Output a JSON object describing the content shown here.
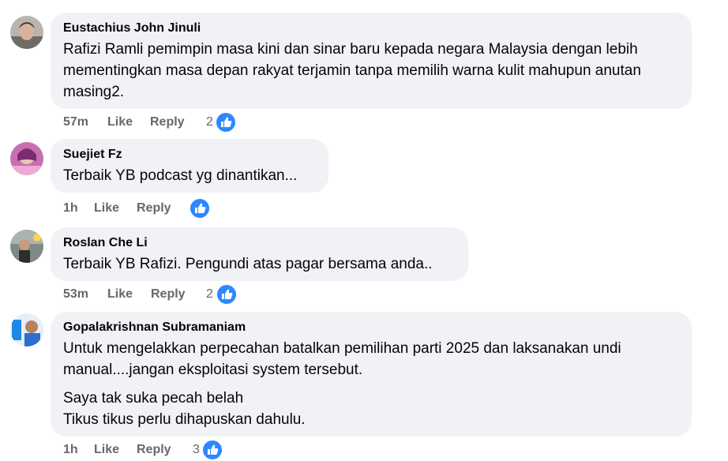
{
  "colors": {
    "bubble_bg": "#f0f2f5",
    "meta_text": "#65676b",
    "like_blue": "#2d88ff"
  },
  "comments": [
    {
      "author": "Eustachius John Jinuli",
      "paragraphs": [
        "Rafizi Ramli pemimpin masa kini dan sinar baru kepada negara Malaysia dengan lebih mementingkan masa depan rakyat terjamin tanpa memilih warna kulit mahupun anutan masing2."
      ],
      "time": "57m",
      "like_label": "Like",
      "reply_label": "Reply",
      "reaction_count": "2",
      "reaction_icon": "thumbs-up-icon"
    },
    {
      "author": "Suejiet Fz",
      "paragraphs": [
        "Terbaik YB podcast yg dinantikan..."
      ],
      "time": "1h",
      "like_label": "Like",
      "reply_label": "Reply",
      "reaction_count": "",
      "reaction_icon": "thumbs-up-icon"
    },
    {
      "author": "Roslan Che Li",
      "paragraphs": [
        "Terbaik YB Rafizi. Pengundi atas pagar bersama anda.."
      ],
      "time": "53m",
      "like_label": "Like",
      "reply_label": "Reply",
      "reaction_count": "2",
      "reaction_icon": "thumbs-up-icon"
    },
    {
      "author": "Gopalakrishnan Subramaniam",
      "paragraphs": [
        "Untuk mengelakkan perpecahan batalkan pemilihan parti 2025 dan laksanakan undi manual....jangan eksploitasi system tersebut.",
        "Saya tak suka pecah belah\nTikus tikus perlu dihapuskan dahulu."
      ],
      "time": "1h",
      "like_label": "Like",
      "reply_label": "Reply",
      "reaction_count": "3",
      "reaction_icon": "thumbs-up-icon"
    }
  ]
}
